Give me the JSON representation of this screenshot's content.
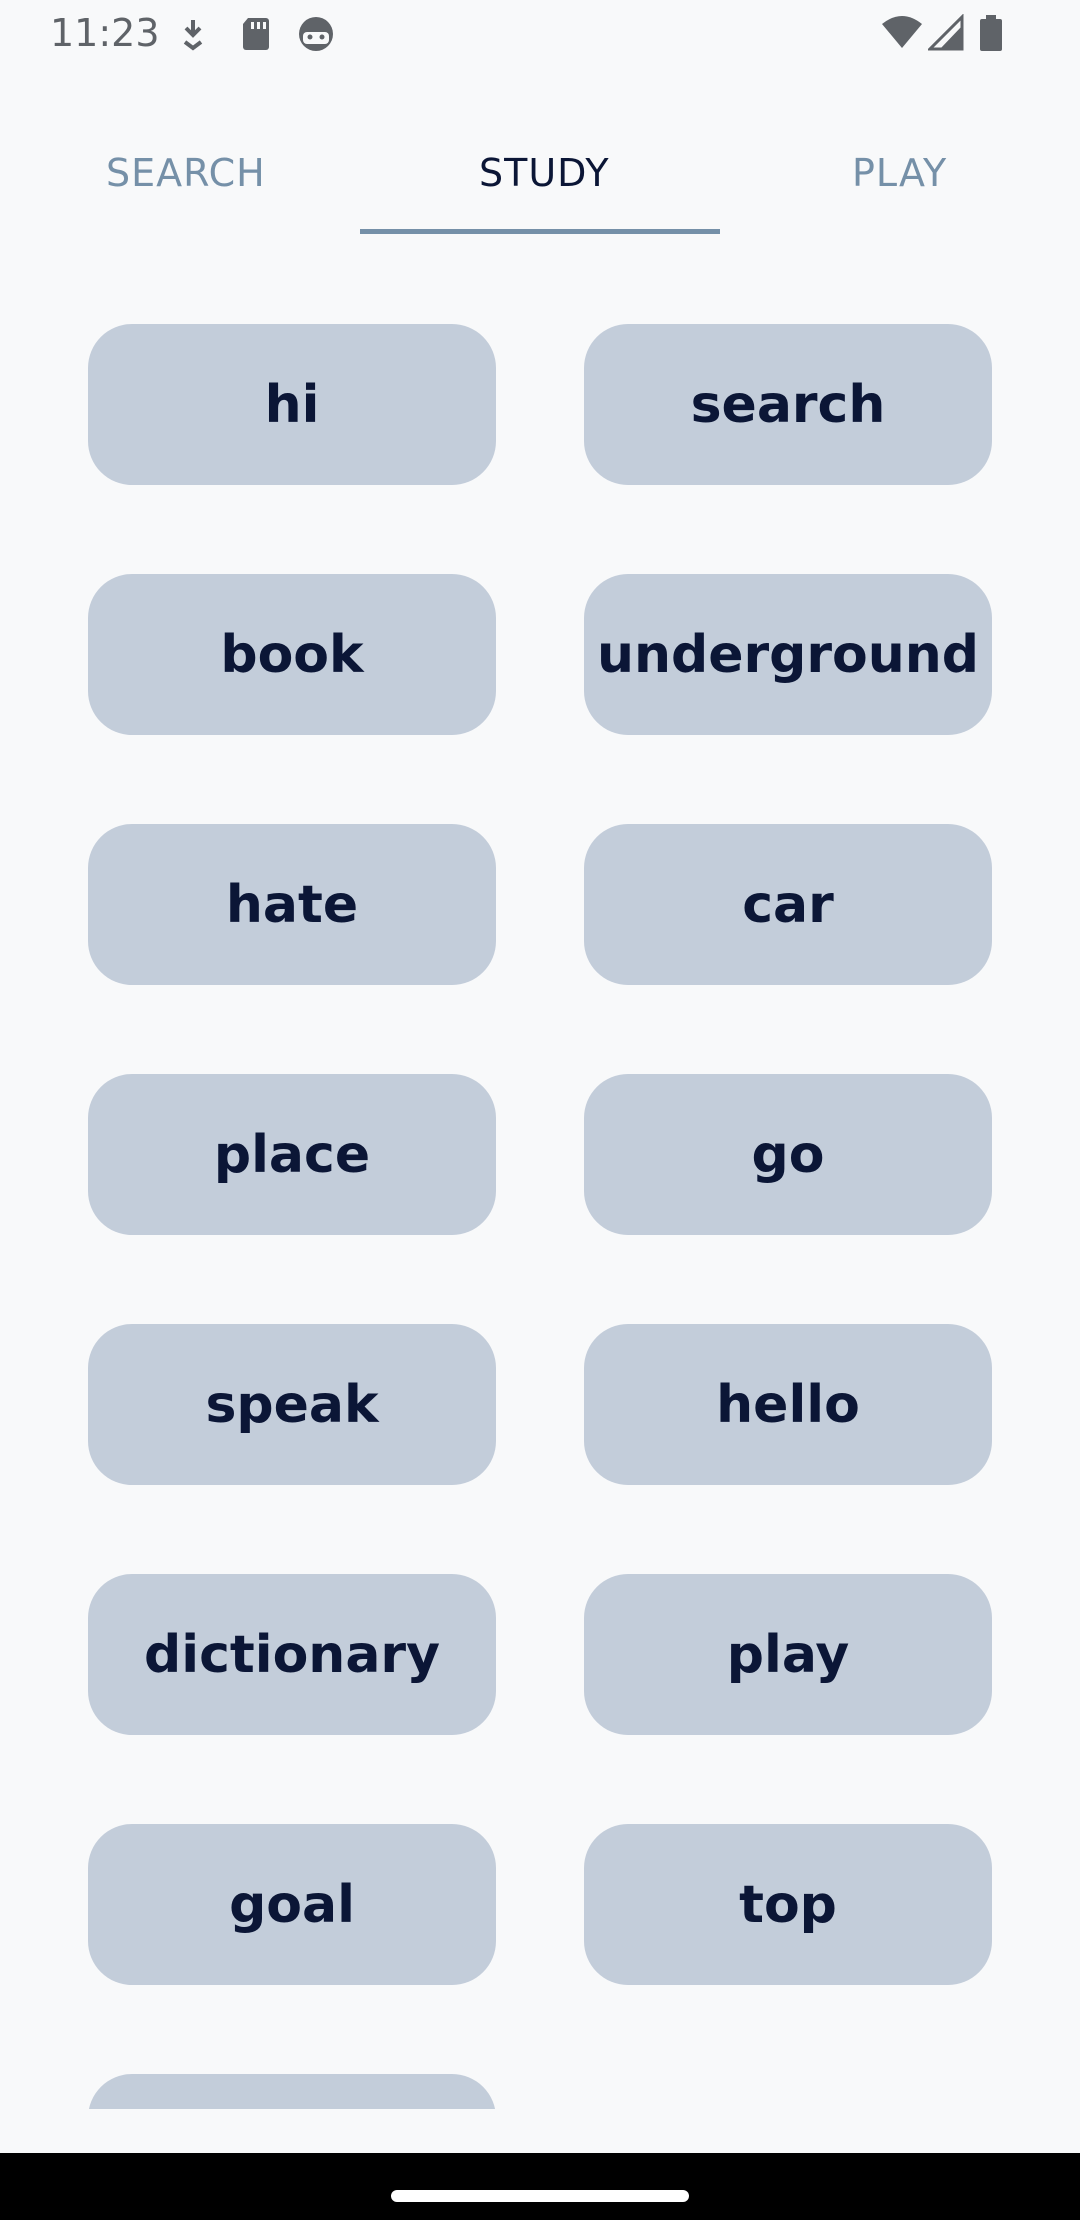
{
  "status_bar": {
    "time": "11:23",
    "icons": [
      "download-icon",
      "sd-card-icon",
      "android-face-icon",
      "wifi-icon",
      "signal-icon",
      "battery-icon"
    ]
  },
  "tabs": [
    {
      "label": "SEARCH",
      "selected": false
    },
    {
      "label": "STUDY",
      "selected": true
    },
    {
      "label": "PLAY",
      "selected": false
    }
  ],
  "words": [
    "hi",
    "search",
    "book",
    "underground",
    "hate",
    "car",
    "place",
    "go",
    "speak",
    "hello",
    "dictionary",
    "play",
    "goal",
    "top",
    ""
  ],
  "colors": {
    "background": "#f8f9fa",
    "card": "#c3cdda",
    "card_text": "#0b1636",
    "tab_inactive": "#7590a8",
    "tab_active": "#0b1636",
    "indicator": "#7590a8"
  }
}
